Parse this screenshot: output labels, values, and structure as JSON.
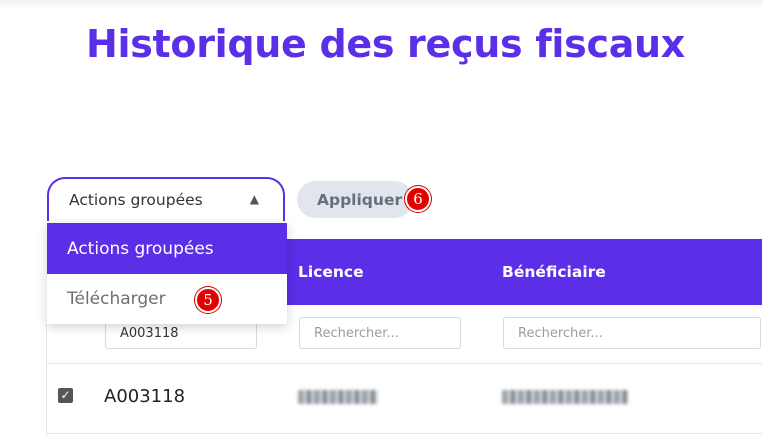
{
  "page": {
    "title": "Historique des reçus fiscaux"
  },
  "bulk_actions": {
    "selected": "Actions groupées",
    "arrow_icon": "triangle-up-icon",
    "options": [
      "Actions groupées",
      "Télécharger"
    ]
  },
  "apply_button": {
    "label": "Appliquer"
  },
  "annotations": {
    "dropdown_option_badge": "5",
    "apply_badge": "6"
  },
  "table": {
    "columns": [
      "Licence",
      "Bénéficiaire"
    ],
    "filters": {
      "id_value": "A003118",
      "licence_placeholder": "Rechercher...",
      "beneficiaire_placeholder": "Rechercher..."
    },
    "rows": [
      {
        "checked": true,
        "id": "A003118",
        "licence_redacted": true,
        "beneficiaire_redacted": true
      }
    ]
  },
  "colors": {
    "accent": "#5b2ee8",
    "badge": "#e50000",
    "button_bg": "#e2e5ec"
  }
}
